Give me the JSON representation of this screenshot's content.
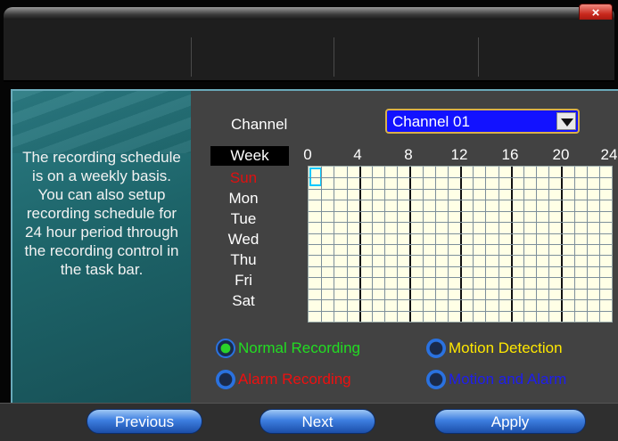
{
  "window": {
    "close_label": "×"
  },
  "sidebar": {
    "help_text": "The recording schedule is on a weekly basis. You can also setup recording schedule for 24 hour period through the recording control in the task bar."
  },
  "channel": {
    "label": "Channel",
    "selected": "Channel 01"
  },
  "schedule": {
    "week_header": "Week",
    "hours": [
      "0",
      "4",
      "8",
      "12",
      "16",
      "20",
      "24"
    ],
    "days": [
      "Sun",
      "Mon",
      "Tue",
      "Wed",
      "Thu",
      "Fri",
      "Sat"
    ]
  },
  "legend": {
    "normal": {
      "label": "Normal Recording",
      "color": "#22dd22",
      "selected": true
    },
    "motion": {
      "label": "Motion Detection",
      "color": "#ffe800",
      "selected": false
    },
    "alarm": {
      "label": "Alarm Recording",
      "color": "#ee1010",
      "selected": false
    },
    "motion_alarm": {
      "label": "Motion and Alarm",
      "color": "#1e1eee",
      "selected": false
    }
  },
  "buttons": {
    "previous": "Previous",
    "next": "Next",
    "apply": "Apply"
  }
}
